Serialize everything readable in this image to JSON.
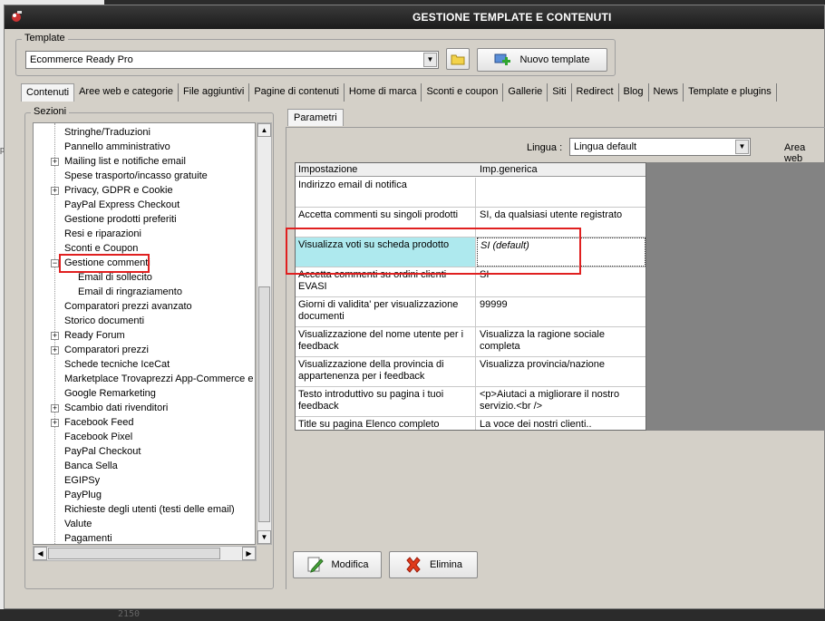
{
  "window": {
    "title": "GESTIONE TEMPLATE E CONTENUTI"
  },
  "template": {
    "group_label": "Template",
    "selected": "Ecommerce Ready Pro",
    "new_button": "Nuovo template"
  },
  "tabs": [
    "Contenuti",
    "Aree web e categorie",
    "File aggiuntivi",
    "Pagine di contenuti",
    "Home di marca",
    "Sconti e coupon",
    "Gallerie",
    "Siti",
    "Redirect",
    "Blog",
    "News",
    "Template e plugins"
  ],
  "sections": {
    "label": "Sezioni",
    "items": [
      "Stringhe/Traduzioni",
      "Pannello amministrativo",
      "Mailing list e notifiche email",
      "Spese trasporto/incasso gratuite",
      "Privacy, GDPR e Cookie",
      "PayPal Express Checkout",
      "Gestione prodotti preferiti",
      "Resi e riparazioni",
      "Sconti e Coupon",
      "Gestione commenti",
      "Email di sollecito",
      "Email di ringraziamento",
      "Comparatori prezzi avanzato",
      "Storico documenti",
      "Ready Forum",
      "Comparatori prezzi",
      "Schede tecniche IceCat",
      "Marketplace Trovaprezzi App-Commerce e Ki",
      "Google Remarketing",
      "Scambio dati rivenditori",
      "Facebook Feed",
      "Facebook Pixel",
      "PayPal Checkout",
      "Banca Sella",
      "EGIPSy",
      "PayPlug",
      "Richieste degli utenti (testi delle email)",
      "Valute",
      "Pagamenti"
    ]
  },
  "params": {
    "tab": "Parametri",
    "lingua_label": "Lingua :",
    "lingua_value": "Lingua default",
    "area_web_label": "Area web",
    "col1": "Impostazione",
    "col2": "Imp.generica",
    "rows": [
      {
        "name": "Indirizzo email di notifica",
        "value": ""
      },
      {
        "name": "Accetta commenti su singoli prodotti",
        "value": "SI, da qualsiasi utente registrato"
      },
      {
        "name": "Visualizza voti su scheda prodotto",
        "value": "SI (default)"
      },
      {
        "name": "Accetta commenti su ordini clienti EVASI",
        "value": "SI"
      },
      {
        "name": "Giorni di validita' per visualizzazione documenti",
        "value": "99999"
      },
      {
        "name": "Visualizzazione del nome utente per i feedback",
        "value": "Visualizza la ragione sociale completa"
      },
      {
        "name": "Visualizzazione della provincia di appartenenza per i feedback",
        "value": "Visualizza provincia/nazione"
      },
      {
        "name": "Testo introduttivo su pagina i tuoi feedback",
        "value": "<p>Aiutaci a migliorare il nostro servizio.<br />"
      },
      {
        "name": "Title su pagina Elenco completo feedback",
        "value": "La voce dei nostri clienti.."
      }
    ],
    "modifica": "Modifica",
    "elimina": "Elimina"
  },
  "background": {
    "bottom_number": "2150"
  }
}
